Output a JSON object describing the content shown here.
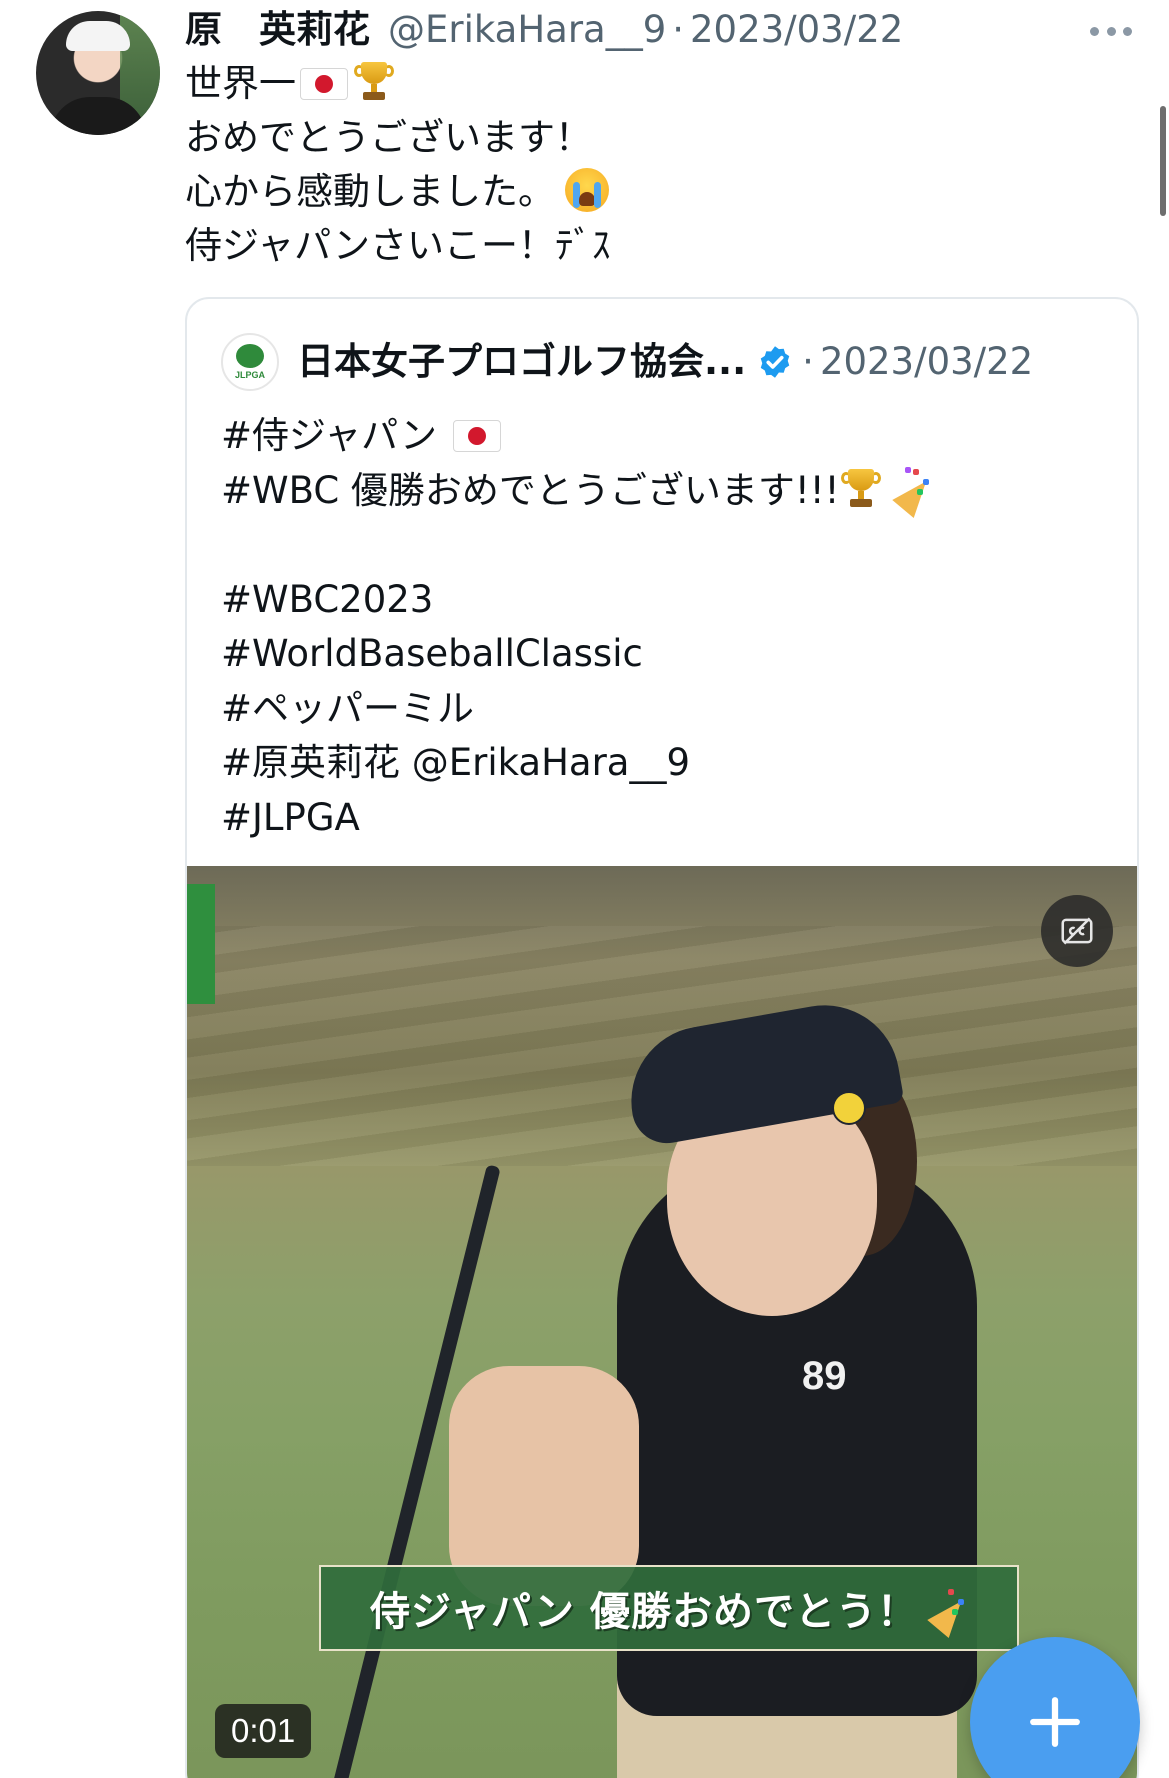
{
  "tweet": {
    "author_name": "原　英莉花",
    "handle": "@ErikaHara__9",
    "separator": "·",
    "date": "2023/03/22",
    "lines": {
      "l1_text": "世界一",
      "l2": "おめでとうございます！",
      "l3_text": "心から感動しました。",
      "l4": "侍ジャパンさいこー！ﾃﾞｽ"
    },
    "emoji": [
      "japan-flag",
      "trophy",
      "loudly-crying-face"
    ]
  },
  "quoted_tweet": {
    "author_name": "日本女子プロゴルフ協会...",
    "verified": true,
    "separator": "·",
    "date": "2023/03/22",
    "logo_text": "JLPGA",
    "lines": {
      "l1_text": "#侍ジャパン",
      "l2_text": "#WBC 優勝おめでとうございます!!!",
      "l3": "#WBC2023",
      "l4": "#WorldBaseballClassic",
      "l5": "#ペッパーミル",
      "l6": "#原英莉花 @ErikaHara__9",
      "l7": "#JLPGA"
    },
    "emoji": [
      "japan-flag",
      "trophy",
      "party-popper"
    ]
  },
  "video": {
    "caption": "侍ジャパン 優勝おめでとう！",
    "caption_emoji": "party-popper",
    "jersey_number": "89",
    "time": "0:01"
  },
  "colors": {
    "accent_blue": "#4a9ef0",
    "verified_blue": "#1d9bf0",
    "secondary_text": "#536471",
    "caption_green": "#306c3c"
  }
}
